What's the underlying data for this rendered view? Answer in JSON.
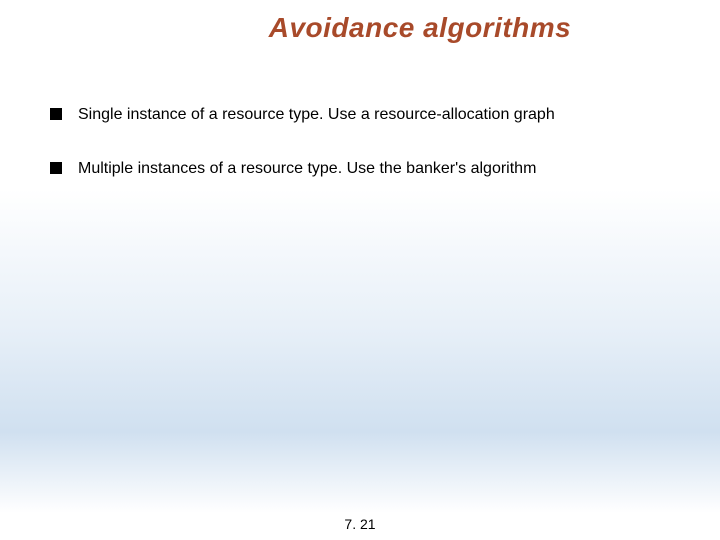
{
  "title": "Avoidance algorithms",
  "bullets": [
    "Single instance of a resource type.  Use a resource-allocation graph",
    "Multiple instances of a resource type.  Use the banker's algorithm"
  ],
  "pageNumber": "7. 21"
}
